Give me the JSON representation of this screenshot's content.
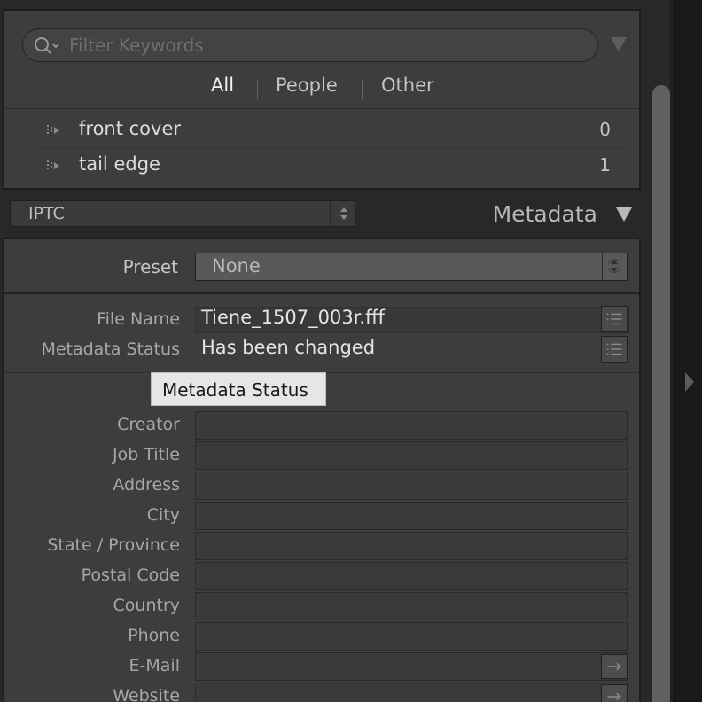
{
  "keyword_list": {
    "search_placeholder": "Filter Keywords",
    "tabs": {
      "all": "All",
      "people": "People",
      "other": "Other"
    },
    "items": [
      {
        "label": "front cover",
        "count": "0"
      },
      {
        "label": "tail edge",
        "count": "1"
      }
    ]
  },
  "metadata_panel": {
    "view_select": "IPTC",
    "title": "Metadata",
    "preset_label": "Preset",
    "preset_value": "None",
    "file_name_label": "File Name",
    "file_name_value": "Tiene_1507_003r.fff",
    "status_label": "Metadata Status",
    "status_value": "Has been changed",
    "tooltip": "Metadata Status",
    "fields": [
      {
        "label": "Creator"
      },
      {
        "label": "Job Title"
      },
      {
        "label": "Address"
      },
      {
        "label": "City"
      },
      {
        "label": "State / Province"
      },
      {
        "label": "Postal Code"
      },
      {
        "label": "Country"
      },
      {
        "label": "Phone"
      },
      {
        "label": "E-Mail"
      },
      {
        "label": "Website"
      }
    ]
  },
  "colors": {
    "panel": "#3d3d3d",
    "background": "#282828",
    "tooltip": "#e6e6e6"
  }
}
